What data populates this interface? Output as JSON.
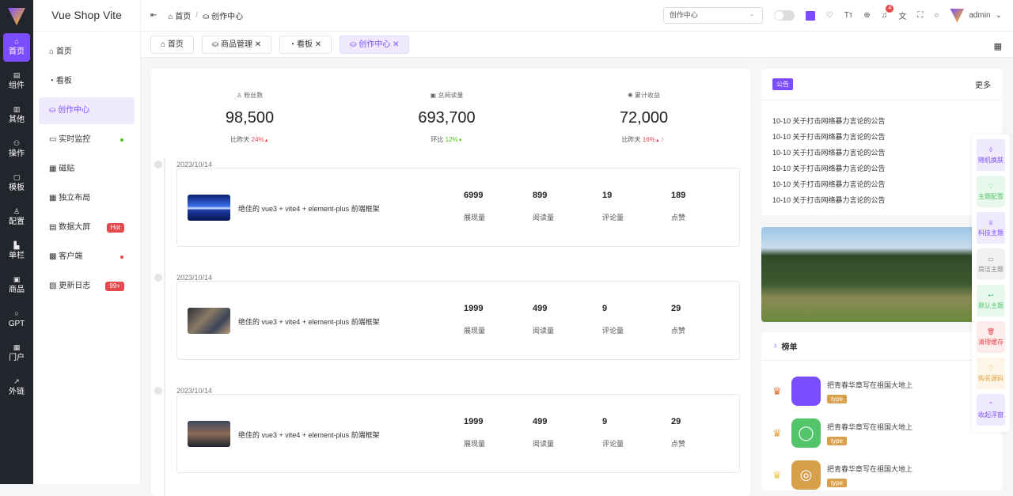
{
  "rail": [
    {
      "label": "首页",
      "icon": "⌂",
      "active": true
    },
    {
      "label": "组件",
      "icon": "▤"
    },
    {
      "label": "其他",
      "icon": "▥"
    },
    {
      "label": "操作",
      "icon": "⚇"
    },
    {
      "label": "模板",
      "icon": "▢"
    },
    {
      "label": "配置",
      "icon": "♙"
    },
    {
      "label": "单栏",
      "icon": "▙"
    },
    {
      "label": "商品",
      "icon": "▣"
    },
    {
      "label": "GPT",
      "icon": "○"
    },
    {
      "label": "门户",
      "icon": "▦"
    },
    {
      "label": "外链",
      "icon": "↗"
    }
  ],
  "brand": "Vue Shop Vite",
  "menu": [
    {
      "label": "首页",
      "icon": "⌂"
    },
    {
      "label": "看板",
      "icon": "◔"
    },
    {
      "label": "创作中心",
      "icon": "⛀",
      "active": true
    },
    {
      "label": "实时监控",
      "icon": "▭",
      "dot": "#52c41a"
    },
    {
      "label": "磁贴",
      "icon": "▦"
    },
    {
      "label": "独立布局",
      "icon": "▦"
    },
    {
      "label": "数据大屏",
      "icon": "▤",
      "badge": "Hot"
    },
    {
      "label": "客户端",
      "icon": "▩",
      "dot": "#e5484d"
    },
    {
      "label": "更新日志",
      "icon": "▧",
      "badge": "99+"
    }
  ],
  "header": {
    "breadcrumb": [
      "首页",
      "/",
      "创作中心"
    ],
    "select": "创作中心",
    "notifications": "4",
    "user": "admin"
  },
  "tabs": [
    {
      "label": "⌂ 首页"
    },
    {
      "label": "⛀ 商品管理 ✕"
    },
    {
      "label": "◔ 看板 ✕"
    },
    {
      "label": "⛀ 创作中心 ✕",
      "active": true
    }
  ],
  "stats": [
    {
      "label": "♙ 粉丝数",
      "value": "98,500",
      "cmp": "比昨天",
      "pct": "24%",
      "arrow": "▲",
      "color": "#e5484d"
    },
    {
      "label": "▣ 总阅读量",
      "value": "693,700",
      "cmp": "环比",
      "pct": "12%",
      "arrow": "▼",
      "color": "#52c41a"
    },
    {
      "label": "✺ 累计收益",
      "value": "72,000",
      "cmp": "比昨天",
      "pct": "16%",
      "arrow": "▲ 〉",
      "color": "#e5484d"
    }
  ],
  "posts": [
    {
      "date": "2023/10/14",
      "title": "绝佳的 vue3 + vite4 + element-plus 前端框架",
      "metrics": [
        "6999",
        "899",
        "19",
        "189"
      ]
    },
    {
      "date": "2023/10/14",
      "title": "绝佳的 vue3 + vite4 + element-plus 前端框架",
      "metrics": [
        "1999",
        "499",
        "9",
        "29"
      ]
    },
    {
      "date": "2023/10/14",
      "title": "绝佳的 vue3 + vite4 + element-plus 前端框架",
      "metrics": [
        "1999",
        "499",
        "9",
        "29"
      ]
    }
  ],
  "metric_labels": [
    "展现量",
    "阅读量",
    "评论量",
    "点赞"
  ],
  "notice": {
    "tag": "公告",
    "more": "更多",
    "items": [
      "10-10 关于打击网络暴力言论的公告",
      "10-10 关于打击网络暴力言论的公告",
      "10-10 关于打击网络暴力言论的公告",
      "10-10 关于打击网络暴力言论的公告",
      "10-10 关于打击网络暴力言论的公告",
      "10-10 关于打击网络暴力言论的公告"
    ]
  },
  "rank": {
    "title": "榜单",
    "items": [
      {
        "text": "把青春华章写在祖国大地上",
        "tag": "type",
        "color": "#7c4dff",
        "icon": "",
        "crown": "#e0702f"
      },
      {
        "text": "把青春华章写在祖国大地上",
        "tag": "type",
        "color": "#52c46a",
        "icon": "◯",
        "crown": "#e8a23c"
      },
      {
        "text": "把青春华章写在祖国大地上",
        "tag": "type",
        "color": "#d9a04b",
        "icon": "◎",
        "crown": "#f0c850"
      }
    ]
  },
  "float": [
    {
      "label": "随机换肤",
      "icon": "◊",
      "bg": "#efeafd",
      "fg": "#7c4dff"
    },
    {
      "label": "主题配置",
      "icon": "♡",
      "bg": "#e8f8ec",
      "fg": "#52c46a"
    },
    {
      "label": "科技主题",
      "icon": "♕",
      "bg": "#efeafd",
      "fg": "#7c4dff"
    },
    {
      "label": "简洁主题",
      "icon": "▭",
      "bg": "#f2f2f2",
      "fg": "#888"
    },
    {
      "label": "默认主题",
      "icon": "↩",
      "bg": "#e8f8ec",
      "fg": "#52c46a"
    },
    {
      "label": "清理缓存",
      "icon": "🗑",
      "bg": "#fdecec",
      "fg": "#e5484d"
    },
    {
      "label": "购买源码",
      "icon": "♡",
      "bg": "#fdf5e8",
      "fg": "#e0a040"
    },
    {
      "label": "收起浮窗",
      "icon": "⌃",
      "bg": "#efeafd",
      "fg": "#7c4dff"
    }
  ]
}
